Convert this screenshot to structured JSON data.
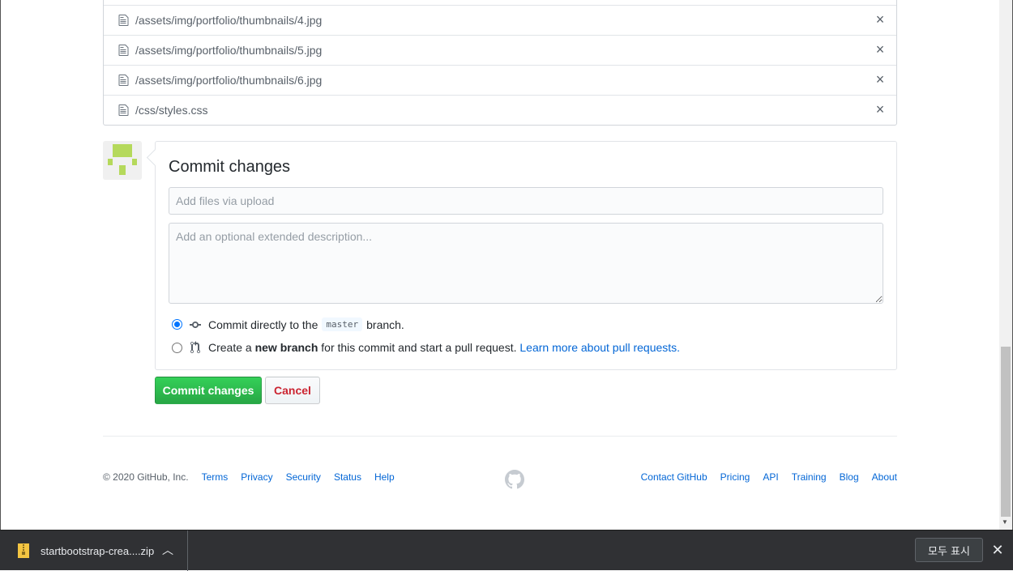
{
  "files": [
    {
      "path": "/assets/img/portfolio/thumbnails/4.jpg"
    },
    {
      "path": "/assets/img/portfolio/thumbnails/5.jpg"
    },
    {
      "path": "/assets/img/portfolio/thumbnails/6.jpg"
    },
    {
      "path": "/css/styles.css"
    }
  ],
  "commit": {
    "title": "Commit changes",
    "summary_placeholder": "Add files via upload",
    "description_placeholder": "Add an optional extended description...",
    "option_direct": {
      "prefix": "Commit directly to the",
      "branch": "master",
      "suffix": "branch."
    },
    "option_new_branch": {
      "prefix": "Create a",
      "bold": "new branch",
      "middle": "for this commit and start a pull request.",
      "link": "Learn more about pull requests."
    },
    "commit_button": "Commit changes",
    "cancel_button": "Cancel"
  },
  "footer": {
    "copyright": "© 2020 GitHub, Inc.",
    "left_links": [
      "Terms",
      "Privacy",
      "Security",
      "Status",
      "Help"
    ],
    "right_links": [
      "Contact GitHub",
      "Pricing",
      "API",
      "Training",
      "Blog",
      "About"
    ]
  },
  "download_bar": {
    "file_name": "startbootstrap-crea....zip",
    "show_all": "모두 표시"
  },
  "colors": {
    "link": "#0366d6",
    "commit_green": "#28a745",
    "cancel_red": "#cb2431",
    "avatar_green": "#b5d95b"
  }
}
